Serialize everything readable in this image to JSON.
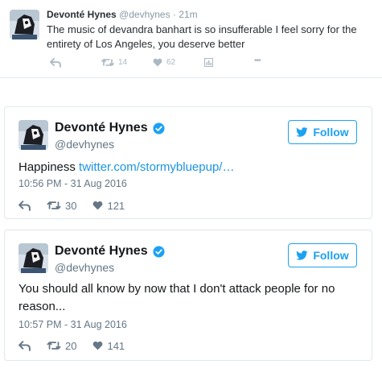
{
  "top_tweet": {
    "name": "Devonté Hynes",
    "handle": "@devhynes",
    "dot": "·",
    "time": "21m",
    "text": "The music of devandra banhart is so insufferable I feel sorry for the entirety of Los Angeles, you deserve better",
    "retweets": "14",
    "likes": "62",
    "more": "•••"
  },
  "tweets": [
    {
      "name": "Devonté Hynes",
      "handle": "@devhynes",
      "follow_label": "Follow",
      "text": "Happiness ",
      "link": "twitter.com/stormybluepup/…",
      "timestamp": "10:56 PM - 31 Aug 2016",
      "retweets": "30",
      "likes": "121"
    },
    {
      "name": "Devonté Hynes",
      "handle": "@devhynes",
      "follow_label": "Follow",
      "text": "You should all know by now that I don't attack people for no reason...",
      "timestamp": "10:57 PM - 31 Aug 2016",
      "retweets": "20",
      "likes": "141"
    }
  ],
  "colors": {
    "brand_blue": "#1da1f2",
    "link_blue": "#1b95e0",
    "verified_blue": "#1da1f2",
    "muted_gray": "#657786"
  },
  "icons": [
    "avatar",
    "reply-icon",
    "retweet-icon",
    "like-icon",
    "analytics-icon",
    "more-icon",
    "verified-badge-icon",
    "twitter-bird-icon"
  ]
}
